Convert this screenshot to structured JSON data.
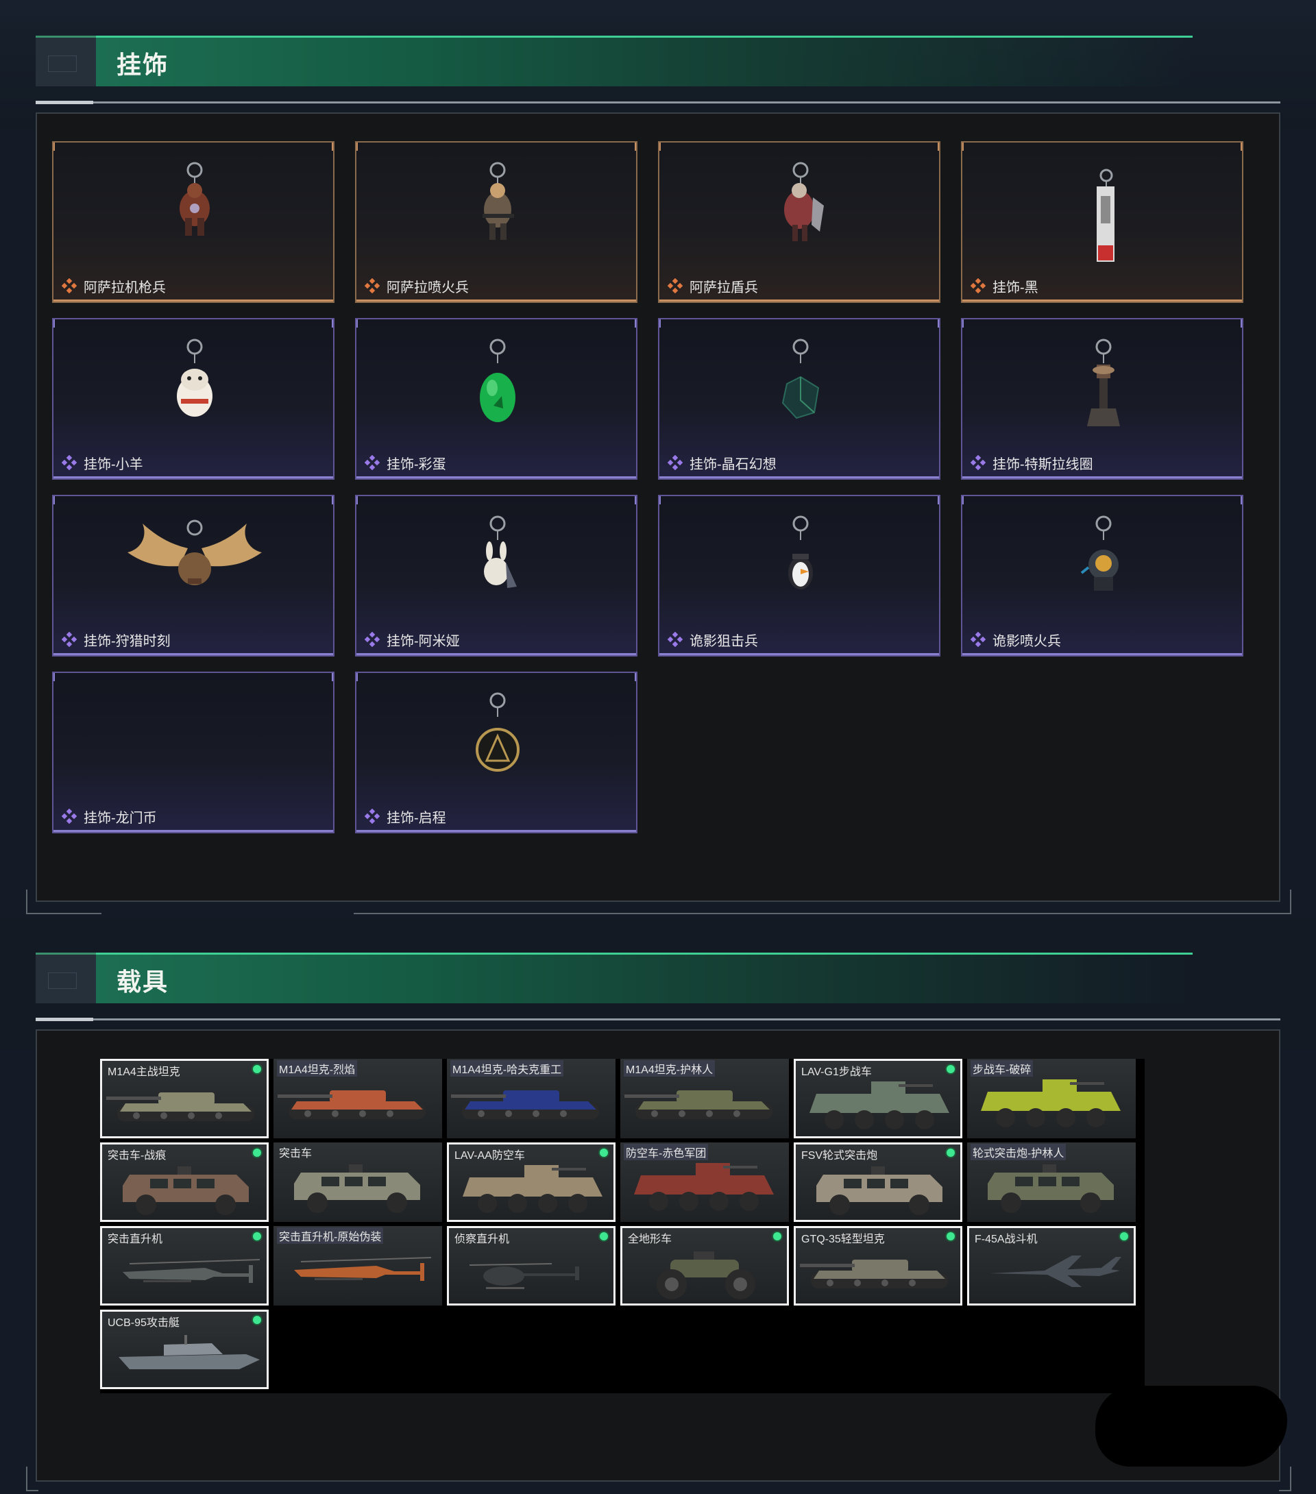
{
  "pendant_section": {
    "title": "挂饰",
    "items": [
      {
        "label": "阿萨拉机枪兵",
        "rarity": "gold",
        "icon": "red-soldier-figurine-icon"
      },
      {
        "label": "阿萨拉喷火兵",
        "rarity": "gold",
        "icon": "soldier-figurine-icon"
      },
      {
        "label": "阿萨拉盾兵",
        "rarity": "gold",
        "icon": "shield-soldier-figurine-icon"
      },
      {
        "label": "挂饰-黑",
        "rarity": "gold",
        "icon": "tag-charm-icon"
      },
      {
        "label": "挂饰-小羊",
        "rarity": "purple",
        "icon": "sheep-charm-icon"
      },
      {
        "label": "挂饰-彩蛋",
        "rarity": "purple",
        "icon": "green-egg-charm-icon"
      },
      {
        "label": "挂饰-晶石幻想",
        "rarity": "purple",
        "icon": "crystal-cube-charm-icon"
      },
      {
        "label": "挂饰-特斯拉线圈",
        "rarity": "purple",
        "icon": "tesla-coil-charm-icon"
      },
      {
        "label": "挂饰-狩猎时刻",
        "rarity": "purple",
        "icon": "antler-charm-icon"
      },
      {
        "label": "挂饰-阿米娅",
        "rarity": "purple",
        "icon": "bunny-charm-icon"
      },
      {
        "label": "诡影狙击兵",
        "rarity": "purple",
        "icon": "penguin-charm-icon"
      },
      {
        "label": "诡影喷火兵",
        "rarity": "purple",
        "icon": "diver-charm-icon"
      },
      {
        "label": "挂饰-龙门币",
        "rarity": "purple",
        "icon": "empty-charm-icon"
      },
      {
        "label": "挂饰-启程",
        "rarity": "purple",
        "icon": "medal-charm-icon"
      }
    ]
  },
  "vehicle_section": {
    "title": "载具",
    "items": [
      {
        "label": "M1A4主战坦克",
        "selected": true,
        "owned": true,
        "tag": false,
        "type": "tank",
        "color": "#8a8a70"
      },
      {
        "label": "M1A4坦克-烈焰",
        "selected": false,
        "owned": false,
        "tag": true,
        "type": "tank",
        "color": "#b85a3a"
      },
      {
        "label": "M1A4坦克-哈夫克重工",
        "selected": false,
        "owned": false,
        "tag": true,
        "type": "tank",
        "color": "#2a3a8a"
      },
      {
        "label": "M1A4坦克-护林人",
        "selected": false,
        "owned": false,
        "tag": true,
        "type": "tank",
        "color": "#6a7050"
      },
      {
        "label": "LAV-G1步战车",
        "selected": true,
        "owned": true,
        "tag": false,
        "type": "apc",
        "color": "#6a7a6a"
      },
      {
        "label": "步战车-破碎",
        "selected": false,
        "owned": false,
        "tag": true,
        "type": "apc",
        "color": "#a8b830"
      },
      {
        "label": "突击车-战痕",
        "selected": true,
        "owned": true,
        "tag": false,
        "type": "truck",
        "color": "#7a6050"
      },
      {
        "label": "突击车",
        "selected": false,
        "owned": false,
        "tag": false,
        "type": "truck",
        "color": "#8a8a78"
      },
      {
        "label": "LAV-AA防空车",
        "selected": true,
        "owned": true,
        "tag": false,
        "type": "apc",
        "color": "#9a8a70"
      },
      {
        "label": "防空车-赤色军团",
        "selected": false,
        "owned": false,
        "tag": true,
        "type": "apc",
        "color": "#8a3a30"
      },
      {
        "label": "FSV轮式突击炮",
        "selected": true,
        "owned": true,
        "tag": false,
        "type": "truck",
        "color": "#9a9080"
      },
      {
        "label": "轮式突击炮-护林人",
        "selected": false,
        "owned": false,
        "tag": true,
        "type": "truck",
        "color": "#6a7058"
      },
      {
        "label": "突击直升机",
        "selected": true,
        "owned": true,
        "tag": false,
        "type": "heli",
        "color": "#5a6060"
      },
      {
        "label": "突击直升机-原始伪装",
        "selected": false,
        "owned": false,
        "tag": true,
        "type": "heli",
        "color": "#b86030"
      },
      {
        "label": "侦察直升机",
        "selected": true,
        "owned": true,
        "tag": false,
        "type": "scout",
        "color": "#3a3e40"
      },
      {
        "label": "全地形车",
        "selected": true,
        "owned": true,
        "tag": false,
        "type": "atv",
        "color": "#5a6048"
      },
      {
        "label": "GTQ-35轻型坦克",
        "selected": true,
        "owned": true,
        "tag": false,
        "type": "tank",
        "color": "#7a7868"
      },
      {
        "label": "F-45A战斗机",
        "selected": true,
        "owned": true,
        "tag": false,
        "type": "jet",
        "color": "#4a5058"
      },
      {
        "label": "UCB-95攻击艇",
        "selected": true,
        "owned": true,
        "tag": false,
        "type": "boat",
        "color": "#707880"
      }
    ]
  }
}
